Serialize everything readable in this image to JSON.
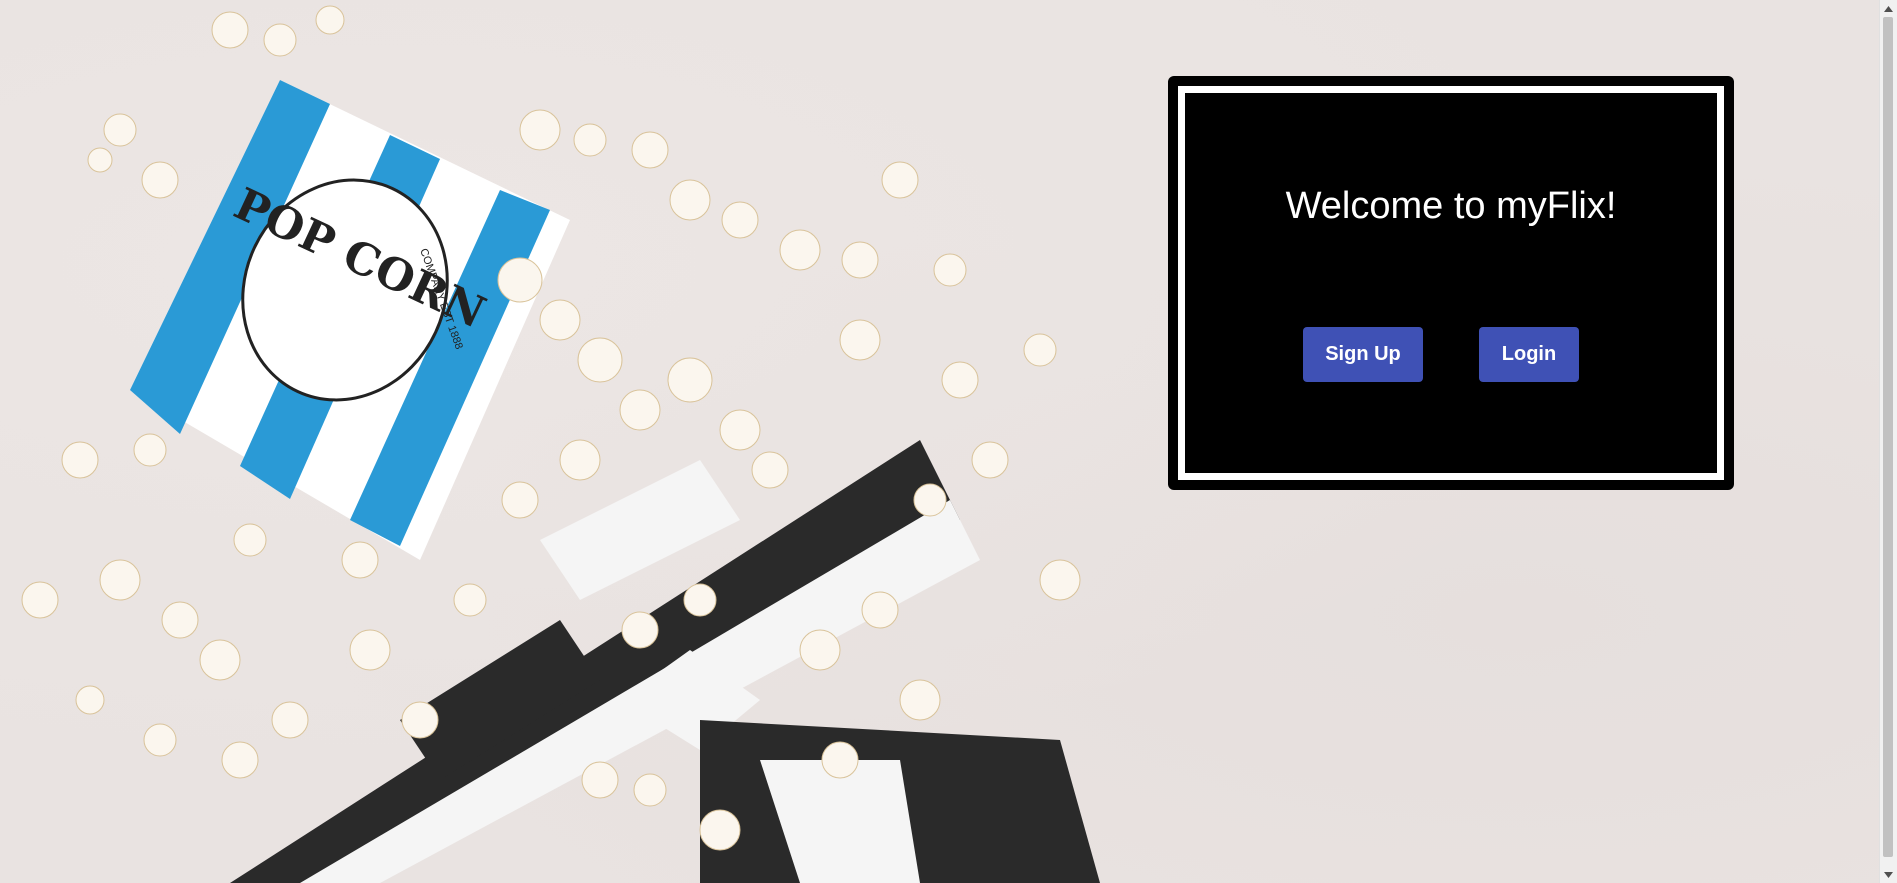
{
  "welcome": {
    "title": "Welcome to myFlix!",
    "signup_label": "Sign Up",
    "login_label": "Login"
  },
  "background": {
    "box_text_1": "COMPANY EST 1888",
    "box_logo": "POP CORN"
  },
  "colors": {
    "button": "#3f51b5",
    "card": "#000000",
    "background": "#e9e3e1"
  },
  "icons": {
    "scroll_up": "scroll-up-arrow-icon",
    "scroll_down": "scroll-down-arrow-icon"
  }
}
